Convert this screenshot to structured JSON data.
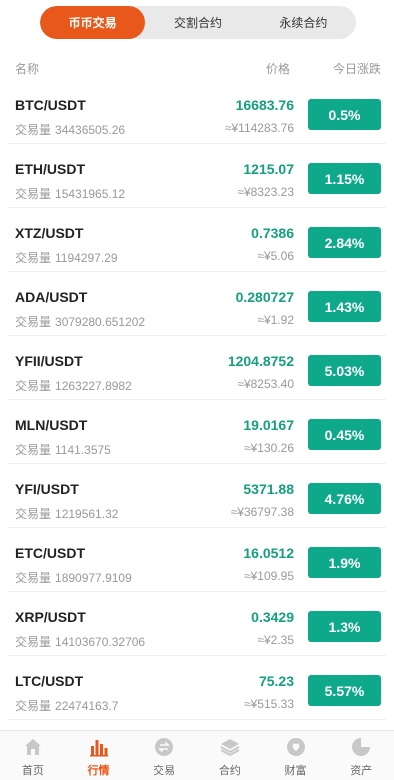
{
  "tabs": [
    {
      "label": "币币交易",
      "active": true
    },
    {
      "label": "交割合约",
      "active": false
    },
    {
      "label": "永续合约",
      "active": false
    }
  ],
  "columns": {
    "name": "名称",
    "price": "价格",
    "change": "今日涨跌"
  },
  "volume_label": "交易量",
  "rows": [
    {
      "pair": "BTC/USDT",
      "volume": "34436505.26",
      "price": "16683.76",
      "cny": "≈¥114283.76",
      "change": "0.5%"
    },
    {
      "pair": "ETH/USDT",
      "volume": "15431965.12",
      "price": "1215.07",
      "cny": "≈¥8323.23",
      "change": "1.15%"
    },
    {
      "pair": "XTZ/USDT",
      "volume": "1194297.29",
      "price": "0.7386",
      "cny": "≈¥5.06",
      "change": "2.84%"
    },
    {
      "pair": "ADA/USDT",
      "volume": "3079280.651202",
      "price": "0.280727",
      "cny": "≈¥1.92",
      "change": "1.43%"
    },
    {
      "pair": "YFII/USDT",
      "volume": "1263227.8982",
      "price": "1204.8752",
      "cny": "≈¥8253.40",
      "change": "5.03%"
    },
    {
      "pair": "MLN/USDT",
      "volume": "1141.3575",
      "price": "19.0167",
      "cny": "≈¥130.26",
      "change": "0.45%"
    },
    {
      "pair": "YFI/USDT",
      "volume": "1219561.32",
      "price": "5371.88",
      "cny": "≈¥36797.38",
      "change": "4.76%"
    },
    {
      "pair": "ETC/USDT",
      "volume": "1890977.9109",
      "price": "16.0512",
      "cny": "≈¥109.95",
      "change": "1.9%"
    },
    {
      "pair": "XRP/USDT",
      "volume": "14103670.32706",
      "price": "0.3429",
      "cny": "≈¥2.35",
      "change": "1.3%"
    },
    {
      "pair": "LTC/USDT",
      "volume": "22474163.7",
      "price": "75.23",
      "cny": "≈¥515.33",
      "change": "5.57%"
    }
  ],
  "tabbar": [
    {
      "label": "首页",
      "icon": "home-icon",
      "active": false
    },
    {
      "label": "行情",
      "icon": "chart-bars-icon",
      "active": true
    },
    {
      "label": "交易",
      "icon": "exchange-icon",
      "active": false
    },
    {
      "label": "合约",
      "icon": "layers-icon",
      "active": false
    },
    {
      "label": "财富",
      "icon": "wealth-icon",
      "active": false
    },
    {
      "label": "资产",
      "icon": "pie-icon",
      "active": false
    }
  ],
  "colors": {
    "accent": "#e8581a",
    "up": "#13a07e",
    "badge": "#0ea98b",
    "icon_inactive": "#c8c8c8"
  }
}
